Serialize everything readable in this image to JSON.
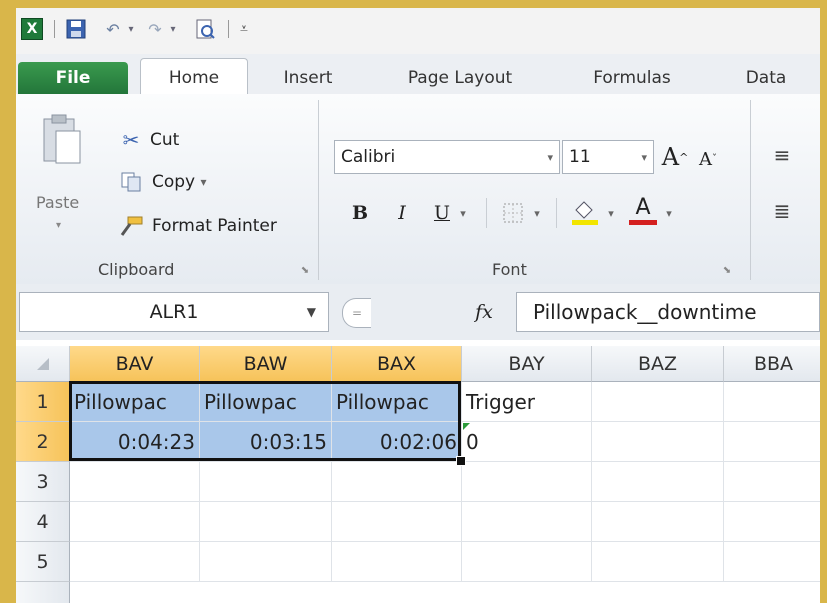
{
  "qat": {
    "icons": [
      "excel-icon",
      "save-icon",
      "undo-icon",
      "redo-icon",
      "print-preview-icon",
      "customize-icon"
    ],
    "excel_glyph": "X"
  },
  "tabs": [
    "File",
    "Home",
    "Insert",
    "Page Layout",
    "Formulas",
    "Data"
  ],
  "ribbon": {
    "clipboard": {
      "paste": "Paste",
      "cut": "Cut",
      "copy": "Copy",
      "copy_arrow": "▾",
      "format_painter": "Format Painter",
      "label": "Clipboard"
    },
    "font": {
      "name": "Calibri",
      "size": "11",
      "bold": "B",
      "italic": "I",
      "underline": "U",
      "font_color": "A",
      "label": "Font"
    }
  },
  "formula_bar": {
    "name_box": "ALR1",
    "fx": "fx",
    "value": "Pillowpack__downtime"
  },
  "grid": {
    "columns": [
      "BAV",
      "BAW",
      "BAX",
      "BAY",
      "BAZ",
      "BBA"
    ],
    "rows": [
      "1",
      "2",
      "3",
      "4",
      "5"
    ],
    "cells": {
      "r1": [
        "Pillowpac",
        "Pillowpac",
        "Pillowpac",
        "Trigger",
        "",
        ""
      ],
      "r2": [
        "0:04:23",
        "0:03:15",
        "0:02:06",
        "0",
        "",
        ""
      ]
    }
  },
  "colors": {
    "file_tab": "#2f8a45",
    "selection": "#a9c7ea",
    "selected_header": "#f6c35a",
    "font_color": "#d42020",
    "highlight": "#f2e500"
  }
}
